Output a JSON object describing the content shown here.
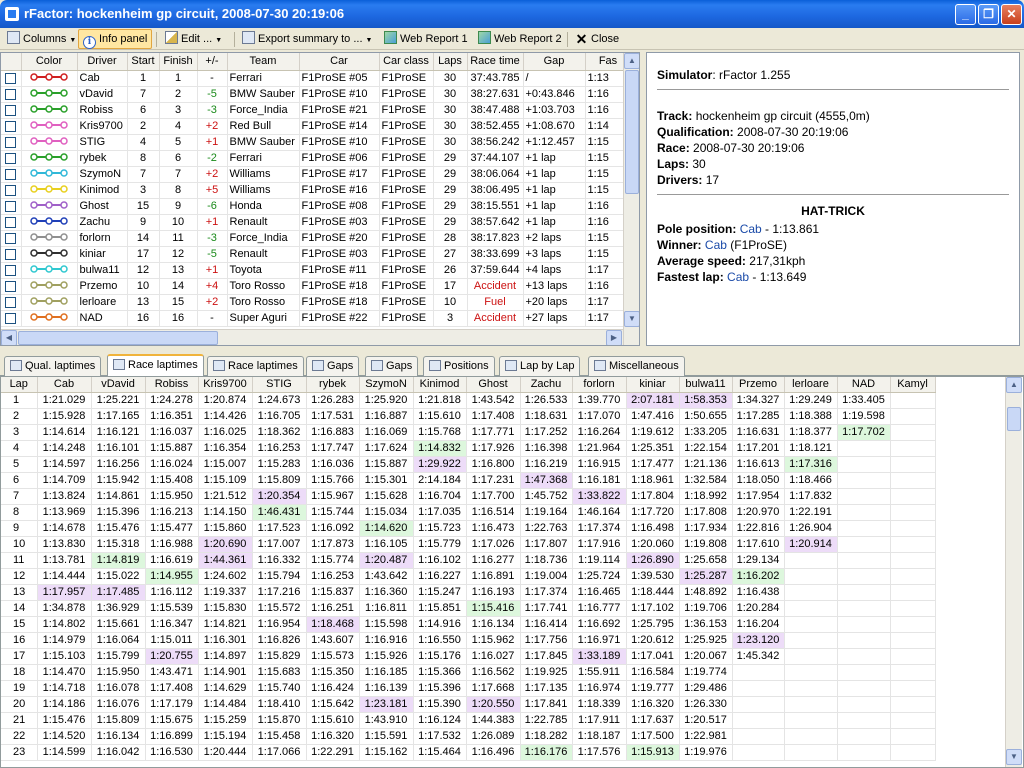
{
  "window": {
    "title": "rFactor: hockenheim gp circuit, 2008-07-30 20:19:06"
  },
  "toolbar": {
    "columns": "Columns",
    "info_panel": "Info panel",
    "edit": "Edit ...",
    "export": "Export summary to ...",
    "web1": "Web Report 1",
    "web2": "Web Report 2",
    "close": "Close"
  },
  "results": {
    "headers": [
      "Color",
      "Driver",
      "Start",
      "Finish",
      "+/-",
      "Team",
      "Car",
      "Car class",
      "Laps",
      "Race time",
      "Gap",
      "Fas"
    ],
    "rows": [
      {
        "color": "#d02020",
        "driver": "Cab",
        "start": "1",
        "finish": "1",
        "delta": "-",
        "team": "Ferrari",
        "car": "F1ProSE    #05",
        "cls": "F1ProSE",
        "laps": "30",
        "time": "37:43.785",
        "gap": "/",
        "fast": "1:13"
      },
      {
        "color": "#2aa02a",
        "driver": "vDavid",
        "start": "7",
        "finish": "2",
        "delta": "-5",
        "team": "BMW Sauber",
        "car": "F1ProSE    #10",
        "cls": "F1ProSE",
        "laps": "30",
        "time": "38:27.631",
        "gap": "+0:43.846",
        "fast": "1:16"
      },
      {
        "color": "#2aa02a",
        "driver": "Robiss",
        "start": "6",
        "finish": "3",
        "delta": "-3",
        "team": "Force_India",
        "car": "F1ProSE    #21",
        "cls": "F1ProSE",
        "laps": "30",
        "time": "38:47.488",
        "gap": "+1:03.703",
        "fast": "1:16"
      },
      {
        "color": "#e060c0",
        "driver": "Kris9700",
        "start": "2",
        "finish": "4",
        "delta": "+2",
        "team": "Red Bull",
        "car": "F1ProSE    #14",
        "cls": "F1ProSE",
        "laps": "30",
        "time": "38:52.455",
        "gap": "+1:08.670",
        "fast": "1:14"
      },
      {
        "color": "#e060c0",
        "driver": "STIG",
        "start": "4",
        "finish": "5",
        "delta": "+1",
        "team": "BMW Sauber",
        "car": "F1ProSE    #10",
        "cls": "F1ProSE",
        "laps": "30",
        "time": "38:56.242",
        "gap": "+1:12.457",
        "fast": "1:15"
      },
      {
        "color": "#2aa02a",
        "driver": "rybek",
        "start": "8",
        "finish": "6",
        "delta": "-2",
        "team": "Ferrari",
        "car": "F1ProSE    #06",
        "cls": "F1ProSE",
        "laps": "29",
        "time": "37:44.107",
        "gap": "+1 lap",
        "fast": "1:15"
      },
      {
        "color": "#30b8d8",
        "driver": "SzymoN",
        "start": "7",
        "finish": "7",
        "delta": "+2",
        "team": "Williams",
        "car": "F1ProSE    #17",
        "cls": "F1ProSE",
        "laps": "29",
        "time": "38:06.064",
        "gap": "+1 lap",
        "fast": "1:15"
      },
      {
        "color": "#e8d020",
        "driver": "Kinimod",
        "start": "3",
        "finish": "8",
        "delta": "+5",
        "team": "Williams",
        "car": "F1ProSE    #16",
        "cls": "F1ProSE",
        "laps": "29",
        "time": "38:06.495",
        "gap": "+1 lap",
        "fast": "1:15"
      },
      {
        "color": "#a060c8",
        "driver": "Ghost",
        "start": "15",
        "finish": "9",
        "delta": "-6",
        "team": "Honda",
        "car": "F1ProSE    #08",
        "cls": "F1ProSE",
        "laps": "29",
        "time": "38:15.551",
        "gap": "+1 lap",
        "fast": "1:16"
      },
      {
        "color": "#2040b8",
        "driver": "Zachu",
        "start": "9",
        "finish": "10",
        "delta": "+1",
        "team": "Renault",
        "car": "F1ProSE    #03",
        "cls": "F1ProSE",
        "laps": "29",
        "time": "38:57.642",
        "gap": "+1 lap",
        "fast": "1:16"
      },
      {
        "color": "#909090",
        "driver": "forlorn",
        "start": "14",
        "finish": "11",
        "delta": "-3",
        "team": "Force_India",
        "car": "F1ProSE    #20",
        "cls": "F1ProSE",
        "laps": "28",
        "time": "38:17.823",
        "gap": "+2 laps",
        "fast": "1:15"
      },
      {
        "color": "#303030",
        "driver": "kiniar",
        "start": "17",
        "finish": "12",
        "delta": "-5",
        "team": "Renault",
        "car": "F1ProSE    #03",
        "cls": "F1ProSE",
        "laps": "27",
        "time": "38:33.699",
        "gap": "+3 laps",
        "fast": "1:15"
      },
      {
        "color": "#30c8d0",
        "driver": "bulwa11",
        "start": "12",
        "finish": "13",
        "delta": "+1",
        "team": "Toyota",
        "car": "F1ProSE    #11",
        "cls": "F1ProSE",
        "laps": "26",
        "time": "37:59.644",
        "gap": "+4 laps",
        "fast": "1:17"
      },
      {
        "color": "#a0a060",
        "driver": "Przemo",
        "start": "10",
        "finish": "14",
        "delta": "+4",
        "team": "Toro Rosso",
        "car": "F1ProSE    #18",
        "cls": "F1ProSE",
        "laps": "17",
        "time": "Accident",
        "gap": "+13 laps",
        "fast": "1:16"
      },
      {
        "color": "#a0a060",
        "driver": "lerloare",
        "start": "13",
        "finish": "15",
        "delta": "+2",
        "team": "Toro Rosso",
        "car": "F1ProSE    #18",
        "cls": "F1ProSE",
        "laps": "10",
        "time": "Fuel",
        "gap": "+20 laps",
        "fast": "1:17"
      },
      {
        "color": "#e07020",
        "driver": "NAD",
        "start": "16",
        "finish": "16",
        "delta": "-",
        "team": "Super Aguri",
        "car": "F1ProSE    #22",
        "cls": "F1ProSE",
        "laps": "3",
        "time": "Accident",
        "gap": "+27 laps",
        "fast": "1:17"
      }
    ]
  },
  "info": {
    "simulator_label": "Simulator",
    "simulator": "rFactor 1.255",
    "track_label": "Track:",
    "track": "hockenheim gp circuit (4555,0m)",
    "qual_label": "Qualification:",
    "qual": "2008-07-30 20:19:06",
    "race_label": "Race:",
    "race": "2008-07-30 20:19:06",
    "laps_label": "Laps:",
    "laps": "30",
    "drivers_label": "Drivers:",
    "drivers": "17",
    "heading": "HAT-TRICK",
    "pole_label": "Pole position:",
    "pole_driver": "Cab",
    "pole_time": " - 1:13.861",
    "winner_label": "Winner:",
    "winner_driver": "Cab",
    "winner_class": " (F1ProSE)",
    "speed_label": "Average speed:",
    "speed": "217,31kph",
    "fastest_label": "Fastest lap:",
    "fastest_driver": "Cab",
    "fastest_time": " - 1:13.649"
  },
  "tabs": [
    "Qual. laptimes",
    "Race laptimes",
    "Race laptimes",
    "Gaps",
    "Gaps",
    "Positions",
    "Lap by Lap",
    "Miscellaneous"
  ],
  "laptimes": {
    "headers": [
      "Lap",
      "Cab",
      "vDavid",
      "Robiss",
      "Kris9700",
      "STIG",
      "rybek",
      "SzymoN",
      "Kinimod",
      "Ghost",
      "Zachu",
      "forlorn",
      "kiniar",
      "bulwa11",
      "Przemo",
      "lerloare",
      "NAD",
      "Kamyl"
    ],
    "rows": [
      [
        "1",
        "1:21.029",
        "1:25.221",
        "1:24.278",
        "1:20.874",
        "1:24.673",
        "1:26.283",
        "1:25.920",
        "1:21.818",
        "1:43.542",
        "1:26.533",
        "1:39.770",
        "2:07.181",
        "1:58.353",
        "1:34.327",
        "1:29.249",
        "1:33.405",
        ""
      ],
      [
        "2",
        "1:15.928",
        "1:17.165",
        "1:16.351",
        "1:14.426",
        "1:16.705",
        "1:17.531",
        "1:16.887",
        "1:15.610",
        "1:17.408",
        "1:18.631",
        "1:17.070",
        "1:47.416",
        "1:50.655",
        "1:17.285",
        "1:18.388",
        "1:19.598",
        ""
      ],
      [
        "3",
        "1:14.614",
        "1:16.121",
        "1:16.037",
        "1:16.025",
        "1:18.362",
        "1:16.883",
        "1:16.069",
        "1:15.768",
        "1:17.771",
        "1:17.252",
        "1:16.264",
        "1:19.612",
        "1:33.205",
        "1:16.631",
        "1:18.377",
        "1:17.702",
        ""
      ],
      [
        "4",
        "1:14.248",
        "1:16.101",
        "1:15.887",
        "1:16.354",
        "1:16.253",
        "1:17.747",
        "1:17.624",
        "1:14.832",
        "1:17.926",
        "1:16.398",
        "1:21.964",
        "1:25.351",
        "1:22.154",
        "1:17.201",
        "1:18.121",
        "",
        ""
      ],
      [
        "5",
        "1:14.597",
        "1:16.256",
        "1:16.024",
        "1:15.007",
        "1:15.283",
        "1:16.036",
        "1:15.887",
        "1:29.922",
        "1:16.800",
        "1:16.219",
        "1:16.915",
        "1:17.477",
        "1:21.136",
        "1:16.613",
        "1:17.316",
        "",
        ""
      ],
      [
        "6",
        "1:14.709",
        "1:15.942",
        "1:15.408",
        "1:15.109",
        "1:15.809",
        "1:15.766",
        "1:15.301",
        "2:14.184",
        "1:17.231",
        "1:47.368",
        "1:16.181",
        "1:18.961",
        "1:32.584",
        "1:18.050",
        "1:18.466",
        "",
        ""
      ],
      [
        "7",
        "1:13.824",
        "1:14.861",
        "1:15.950",
        "1:21.512",
        "1:20.354",
        "1:15.967",
        "1:15.628",
        "1:16.704",
        "1:17.700",
        "1:45.752",
        "1:33.822",
        "1:17.804",
        "1:18.992",
        "1:17.954",
        "1:17.832",
        "",
        ""
      ],
      [
        "8",
        "1:13.969",
        "1:15.396",
        "1:16.213",
        "1:14.150",
        "1:46.431",
        "1:15.744",
        "1:15.034",
        "1:17.035",
        "1:16.514",
        "1:19.164",
        "1:46.164",
        "1:17.720",
        "1:17.808",
        "1:20.970",
        "1:22.191",
        "",
        ""
      ],
      [
        "9",
        "1:14.678",
        "1:15.476",
        "1:15.477",
        "1:15.860",
        "1:17.523",
        "1:16.092",
        "1:14.620",
        "1:15.723",
        "1:16.473",
        "1:22.763",
        "1:17.374",
        "1:16.498",
        "1:17.934",
        "1:22.816",
        "1:26.904",
        "",
        ""
      ],
      [
        "10",
        "1:13.830",
        "1:15.318",
        "1:16.988",
        "1:20.690",
        "1:17.007",
        "1:17.873",
        "1:16.105",
        "1:15.779",
        "1:17.026",
        "1:17.807",
        "1:17.916",
        "1:20.060",
        "1:19.808",
        "1:17.610",
        "1:20.914",
        "",
        ""
      ],
      [
        "11",
        "1:13.781",
        "1:14.819",
        "1:16.619",
        "1:44.361",
        "1:16.332",
        "1:15.774",
        "1:20.487",
        "1:16.102",
        "1:16.277",
        "1:18.736",
        "1:19.114",
        "1:26.890",
        "1:25.658",
        "1:29.134",
        "",
        "",
        ""
      ],
      [
        "12",
        "1:14.444",
        "1:15.022",
        "1:14.955",
        "1:24.602",
        "1:15.794",
        "1:16.253",
        "1:43.642",
        "1:16.227",
        "1:16.891",
        "1:19.004",
        "1:25.724",
        "1:39.530",
        "1:25.287",
        "1:16.202",
        "",
        "",
        ""
      ],
      [
        "13",
        "1:17.957",
        "1:17.485",
        "1:16.112",
        "1:19.337",
        "1:17.216",
        "1:15.837",
        "1:16.360",
        "1:15.247",
        "1:16.193",
        "1:17.374",
        "1:16.465",
        "1:18.444",
        "1:48.892",
        "1:16.438",
        "",
        "",
        ""
      ],
      [
        "14",
        "1:34.878",
        "1:36.929",
        "1:15.539",
        "1:15.830",
        "1:15.572",
        "1:16.251",
        "1:16.811",
        "1:15.851",
        "1:15.416",
        "1:17.741",
        "1:16.777",
        "1:17.102",
        "1:19.706",
        "1:20.284",
        "",
        "",
        ""
      ],
      [
        "15",
        "1:14.802",
        "1:15.661",
        "1:16.347",
        "1:14.821",
        "1:16.954",
        "1:18.468",
        "1:15.598",
        "1:14.916",
        "1:16.134",
        "1:16.414",
        "1:16.692",
        "1:25.795",
        "1:36.153",
        "1:16.204",
        "",
        "",
        ""
      ],
      [
        "16",
        "1:14.979",
        "1:16.064",
        "1:15.011",
        "1:16.301",
        "1:16.826",
        "1:43.607",
        "1:16.916",
        "1:16.550",
        "1:15.962",
        "1:17.756",
        "1:16.971",
        "1:20.612",
        "1:25.925",
        "1:23.120",
        "",
        "",
        ""
      ],
      [
        "17",
        "1:15.103",
        "1:15.799",
        "1:20.755",
        "1:14.897",
        "1:15.829",
        "1:15.573",
        "1:15.926",
        "1:15.176",
        "1:16.027",
        "1:17.845",
        "1:33.189",
        "1:17.041",
        "1:20.067",
        "1:45.342",
        "",
        "",
        ""
      ],
      [
        "18",
        "1:14.470",
        "1:15.950",
        "1:43.471",
        "1:14.901",
        "1:15.683",
        "1:15.350",
        "1:16.185",
        "1:15.366",
        "1:16.562",
        "1:19.925",
        "1:55.911",
        "1:16.584",
        "1:19.774",
        "",
        "",
        "",
        ""
      ],
      [
        "19",
        "1:14.718",
        "1:16.078",
        "1:17.408",
        "1:14.629",
        "1:15.740",
        "1:16.424",
        "1:16.139",
        "1:15.396",
        "1:17.668",
        "1:17.135",
        "1:16.974",
        "1:19.777",
        "1:29.486",
        "",
        "",
        "",
        ""
      ],
      [
        "20",
        "1:14.186",
        "1:16.076",
        "1:17.179",
        "1:14.484",
        "1:18.410",
        "1:15.642",
        "1:23.181",
        "1:15.390",
        "1:20.550",
        "1:17.841",
        "1:18.339",
        "1:16.320",
        "1:26.330",
        "",
        "",
        "",
        ""
      ],
      [
        "21",
        "1:15.476",
        "1:15.809",
        "1:15.675",
        "1:15.259",
        "1:15.870",
        "1:15.610",
        "1:43.910",
        "1:16.124",
        "1:44.383",
        "1:22.785",
        "1:17.911",
        "1:17.637",
        "1:20.517",
        "",
        "",
        "",
        ""
      ],
      [
        "22",
        "1:14.520",
        "1:16.134",
        "1:16.899",
        "1:15.194",
        "1:15.458",
        "1:16.320",
        "1:15.591",
        "1:17.532",
        "1:26.089",
        "1:18.282",
        "1:18.187",
        "1:17.500",
        "1:22.981",
        "",
        "",
        "",
        ""
      ],
      [
        "23",
        "1:14.599",
        "1:16.042",
        "1:16.530",
        "1:20.444",
        "1:17.066",
        "1:22.291",
        "1:15.162",
        "1:15.464",
        "1:16.496",
        "1:16.176",
        "1:17.576",
        "1:15.913",
        "1:19.976",
        "",
        "",
        "",
        ""
      ]
    ]
  }
}
